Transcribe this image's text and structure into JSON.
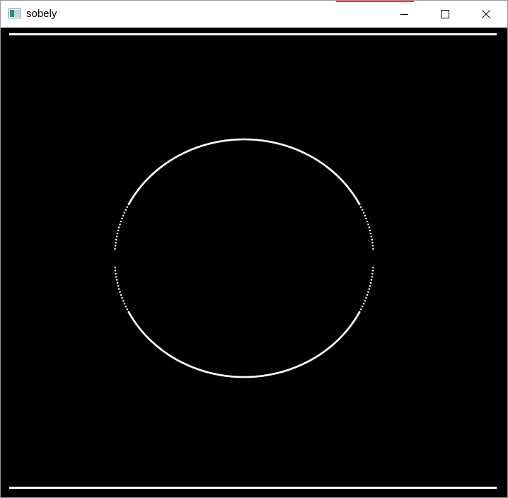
{
  "window": {
    "title": "sobely"
  },
  "icons": {
    "app": "opencv-window-icon",
    "minimize": "minimize-icon",
    "maximize": "maximize-icon",
    "close": "close-icon"
  },
  "colors": {
    "titlebar_bg": "#ffffff",
    "canvas_bg": "#000000",
    "edge_lines": "#ffffff",
    "accent": "#d83b3b"
  }
}
